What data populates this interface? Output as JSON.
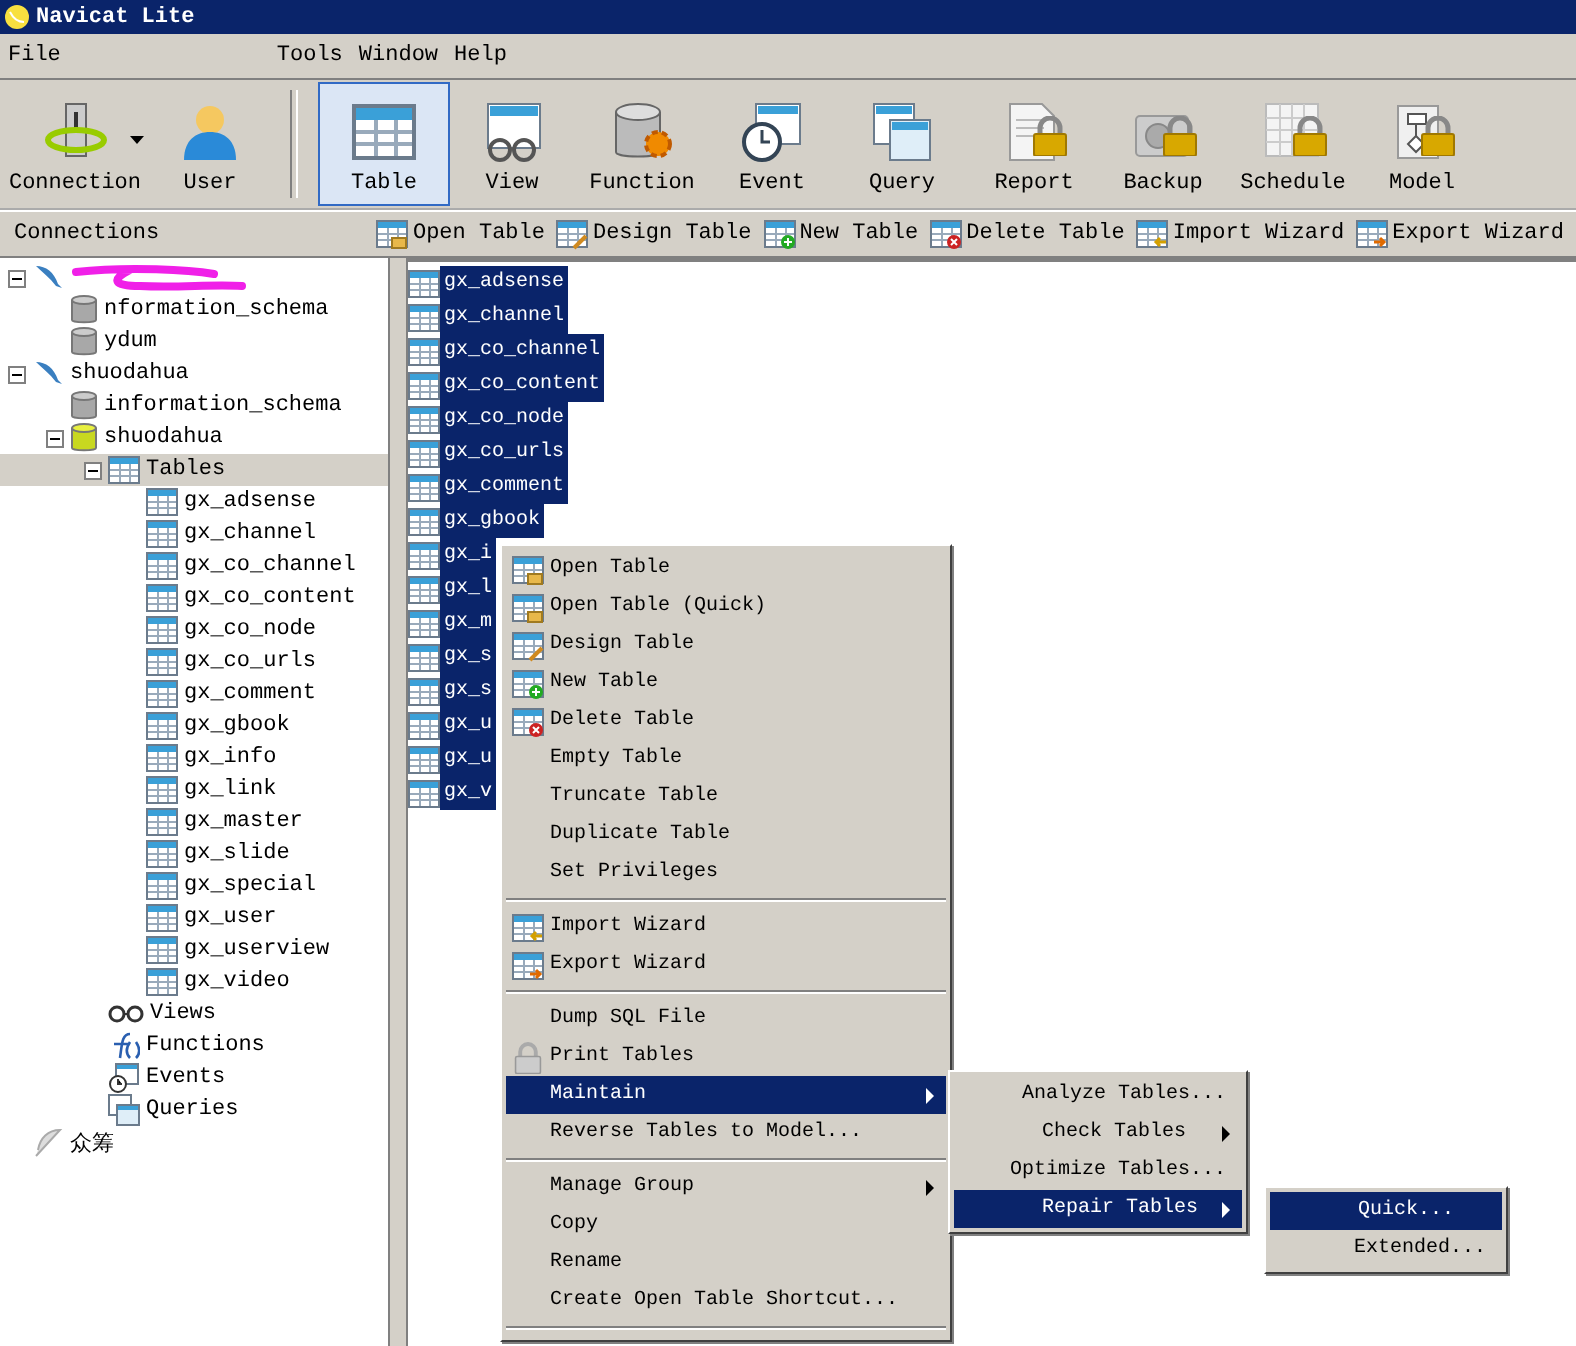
{
  "window": {
    "title": "Navicat Lite"
  },
  "menu": [
    "File",
    "Tools",
    "Window",
    "Help"
  ],
  "toolbar": [
    {
      "label": "Connection",
      "selected": false,
      "locked": false,
      "dropdown": true
    },
    {
      "label": "User",
      "selected": false,
      "locked": false,
      "dropdown": false
    },
    {
      "label": "Table",
      "selected": true,
      "locked": false,
      "dropdown": false
    },
    {
      "label": "View",
      "selected": false,
      "locked": false,
      "dropdown": false
    },
    {
      "label": "Function",
      "selected": false,
      "locked": false,
      "dropdown": false
    },
    {
      "label": "Event",
      "selected": false,
      "locked": false,
      "dropdown": false
    },
    {
      "label": "Query",
      "selected": false,
      "locked": false,
      "dropdown": false
    },
    {
      "label": "Report",
      "selected": false,
      "locked": true,
      "dropdown": false
    },
    {
      "label": "Backup",
      "selected": false,
      "locked": true,
      "dropdown": false
    },
    {
      "label": "Schedule",
      "selected": false,
      "locked": true,
      "dropdown": false
    },
    {
      "label": "Model",
      "selected": false,
      "locked": true,
      "dropdown": false
    }
  ],
  "panel_title": "Connections",
  "actions": [
    "Open Table",
    "Design Table",
    "New Table",
    "Delete Table",
    "Import Wizard",
    "Export Wizard"
  ],
  "tree": [
    {
      "kind": "connection",
      "expanded": true,
      "selected": false,
      "children": [
        {
          "kind": "database",
          "label": "nformation_schema",
          "selected": false
        },
        {
          "kind": "database",
          "label": "ydum",
          "selected": false
        }
      ]
    },
    {
      "kind": "connection",
      "label": "shuodahua",
      "expanded": true,
      "selected": false,
      "children": [
        {
          "kind": "database",
          "label": "information_schema",
          "selected": false
        },
        {
          "kind": "database_open",
          "label": "shuodahua",
          "expanded": true,
          "selected": false,
          "children": [
            {
              "kind": "tables",
              "label": "Tables",
              "expanded": true,
              "selected": true,
              "children": [
                {
                  "kind": "table",
                  "label": "gx_adsense",
                  "selected": false
                },
                {
                  "kind": "table",
                  "label": "gx_channel",
                  "selected": false
                },
                {
                  "kind": "table",
                  "label": "gx_co_channel",
                  "selected": false
                },
                {
                  "kind": "table",
                  "label": "gx_co_content",
                  "selected": false
                },
                {
                  "kind": "table",
                  "label": "gx_co_node",
                  "selected": false
                },
                {
                  "kind": "table",
                  "label": "gx_co_urls",
                  "selected": false
                },
                {
                  "kind": "table",
                  "label": "gx_comment",
                  "selected": false
                },
                {
                  "kind": "table",
                  "label": "gx_gbook",
                  "selected": false
                },
                {
                  "kind": "table",
                  "label": "gx_info",
                  "selected": false
                },
                {
                  "kind": "table",
                  "label": "gx_link",
                  "selected": false
                },
                {
                  "kind": "table",
                  "label": "gx_master",
                  "selected": false
                },
                {
                  "kind": "table",
                  "label": "gx_slide",
                  "selected": false
                },
                {
                  "kind": "table",
                  "label": "gx_special",
                  "selected": false
                },
                {
                  "kind": "table",
                  "label": "gx_user",
                  "selected": false
                },
                {
                  "kind": "table",
                  "label": "gx_userview",
                  "selected": false
                },
                {
                  "kind": "table",
                  "label": "gx_video",
                  "selected": false
                }
              ]
            },
            {
              "kind": "views",
              "label": "Views",
              "selected": false
            },
            {
              "kind": "functions",
              "label": "Functions",
              "selected": false
            },
            {
              "kind": "events",
              "label": "Events",
              "selected": false
            },
            {
              "kind": "queries",
              "label": "Queries",
              "selected": false
            }
          ]
        }
      ]
    },
    {
      "kind": "group",
      "label": "众筹",
      "selected": false
    }
  ],
  "tables": [
    {
      "label": "gx_adsense",
      "selected": true
    },
    {
      "label": "gx_channel",
      "selected": true
    },
    {
      "label": "gx_co_channel",
      "selected": true
    },
    {
      "label": "gx_co_content",
      "selected": true
    },
    {
      "label": "gx_co_node",
      "selected": true
    },
    {
      "label": "gx_co_urls",
      "selected": true
    },
    {
      "label": "gx_comment",
      "selected": true
    },
    {
      "label": "gx_gbook",
      "selected": true
    },
    {
      "label": "gx_i",
      "selected": true
    },
    {
      "label": "gx_l",
      "selected": true
    },
    {
      "label": "gx_m",
      "selected": true
    },
    {
      "label": "gx_s",
      "selected": true
    },
    {
      "label": "gx_s",
      "selected": true
    },
    {
      "label": "gx_u",
      "selected": true
    },
    {
      "label": "gx_u",
      "selected": true
    },
    {
      "label": "gx_v",
      "selected": true
    }
  ],
  "context_menu": [
    {
      "kind": "item",
      "label": "Open Table",
      "selected": false,
      "submenu": false
    },
    {
      "kind": "item",
      "label": "Open Table (Quick)",
      "selected": false,
      "submenu": false
    },
    {
      "kind": "item",
      "label": "Design Table",
      "selected": false,
      "submenu": false
    },
    {
      "kind": "item",
      "label": "New Table",
      "selected": false,
      "submenu": false
    },
    {
      "kind": "item",
      "label": "Delete Table",
      "selected": false,
      "submenu": false
    },
    {
      "kind": "item",
      "label": "Empty Table",
      "selected": false,
      "submenu": false
    },
    {
      "kind": "item",
      "label": "Truncate Table",
      "selected": false,
      "submenu": false
    },
    {
      "kind": "item",
      "label": "Duplicate Table",
      "selected": false,
      "submenu": false
    },
    {
      "kind": "item",
      "label": "Set Privileges",
      "selected": false,
      "submenu": false
    },
    {
      "kind": "separator"
    },
    {
      "kind": "item",
      "label": "Import Wizard",
      "selected": false,
      "submenu": false
    },
    {
      "kind": "item",
      "label": "Export Wizard",
      "selected": false,
      "submenu": false
    },
    {
      "kind": "separator"
    },
    {
      "kind": "item",
      "label": "Dump SQL File",
      "selected": false,
      "submenu": false
    },
    {
      "kind": "item",
      "label": "Print Tables",
      "selected": false,
      "submenu": false
    },
    {
      "kind": "item",
      "label": "Maintain",
      "selected": true,
      "submenu": true
    },
    {
      "kind": "item",
      "label": "Reverse Tables to Model...",
      "selected": false,
      "submenu": false
    },
    {
      "kind": "separator"
    },
    {
      "kind": "item",
      "label": "Manage Group",
      "selected": false,
      "submenu": true
    },
    {
      "kind": "item",
      "label": "Copy",
      "selected": false,
      "submenu": false
    },
    {
      "kind": "item",
      "label": "Rename",
      "selected": false,
      "submenu": false
    },
    {
      "kind": "item",
      "label": "Create Open Table Shortcut...",
      "selected": false,
      "submenu": false
    },
    {
      "kind": "separator"
    }
  ],
  "maintain_menu": [
    {
      "label": "Analyze Tables...",
      "selected": false,
      "submenu": false
    },
    {
      "label": "Check Tables",
      "selected": false,
      "submenu": true
    },
    {
      "label": "Optimize Tables...",
      "selected": false,
      "submenu": false
    },
    {
      "label": "Repair Tables",
      "selected": true,
      "submenu": true
    }
  ],
  "repair_menu": [
    {
      "label": "Quick...",
      "selected": true,
      "submenu": false
    },
    {
      "label": "Extended...",
      "selected": false,
      "submenu": false
    }
  ]
}
